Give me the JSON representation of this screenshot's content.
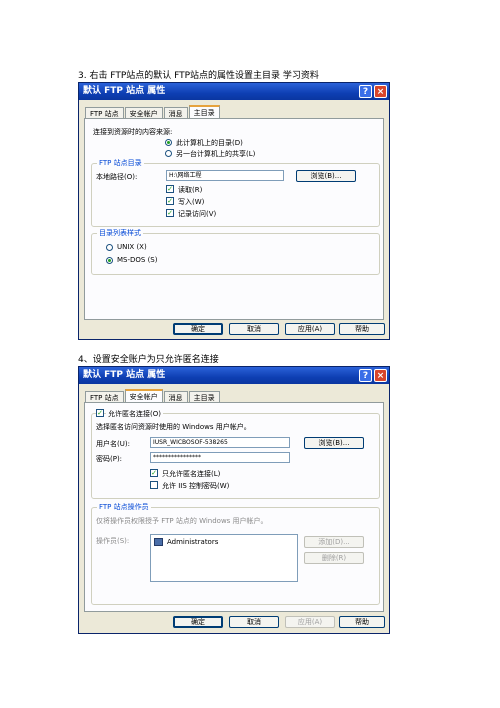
{
  "captions": {
    "step3": "3. 右击 FTP站点的默认 FTP站点的属性设置主目录 学习资料",
    "step4": "4、设置安全账户为只允许匿名连接"
  },
  "dialog1": {
    "title": "默认 FTP 站点 属性",
    "tabs": [
      "FTP 站点",
      "安全帐户",
      "消息",
      "主目录"
    ],
    "source_label": "连接到资源时的内容来源:",
    "radio_local": "此计算机上的目录(D)",
    "radio_share": "另一台计算机上的共享(L)",
    "group_dir_title": "FTP 站点目录",
    "local_path_label": "本地路径(O):",
    "local_path_value": "H:\\网络工程",
    "browse_label": "浏览(B)...",
    "chk_read": "读取(R)",
    "chk_write": "写入(W)",
    "chk_log": "记录访问(V)",
    "group_listing_title": "目录列表样式",
    "radio_unix": "UNIX (X)",
    "radio_msdos": "MS-DOS (S)",
    "ok": "确定",
    "cancel": "取消",
    "apply": "应用(A)",
    "help": "帮助"
  },
  "dialog2": {
    "title": "默认 FTP 站点 属性",
    "tabs": [
      "FTP 站点",
      "安全帐户",
      "消息",
      "主目录"
    ],
    "allow_anon": "允许匿名连接(O)",
    "select_account": "选择匿名访问资源时使用的 Windows 用户帐户。",
    "username_label": "用户名(U):",
    "username_value": "IUSR_WICBOSOF-538265",
    "browse_label": "浏览(B)...",
    "password_label": "密码(P):",
    "password_value": "****************",
    "only_anon": "只允许匿名连接(L)",
    "iis_pwd": "允许 IIS 控制密码(W)",
    "operators_group_title": "FTP 站点操作员",
    "operators_desc": "仅将操作员权限授予 FTP 站点的 Windows 用户帐户。",
    "operators_label": "操作员(S):",
    "operator_item": "Administrators",
    "add_label": "添加(D)...",
    "remove_label": "删除(R)",
    "ok": "确定",
    "cancel": "取消",
    "apply": "应用(A)",
    "help": "帮助"
  },
  "titlebar_buttons": {
    "help": "?",
    "close": "×"
  },
  "colors": {
    "title_blue": "#0e3fb3",
    "dialog_bg": "#ece9d8",
    "accent_tab": "#e6a23c",
    "check_green": "#21a121"
  }
}
